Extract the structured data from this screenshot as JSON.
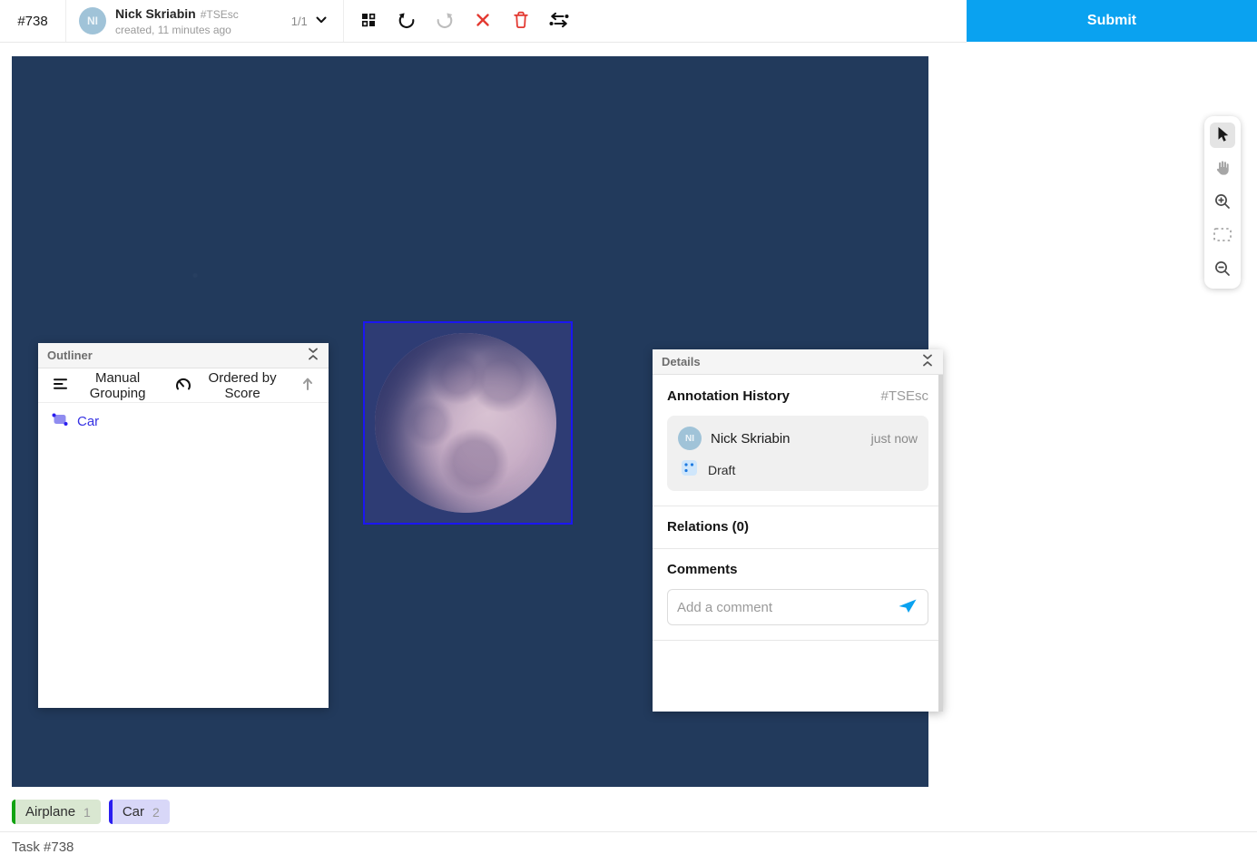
{
  "header": {
    "task_id": "#738",
    "user": {
      "initials": "NI",
      "name": "Nick Skriabin",
      "ref": "#TSEsc",
      "created": "created, 11 minutes ago"
    },
    "pager": "1/1",
    "submit_label": "Submit"
  },
  "outliner": {
    "title": "Outliner",
    "grouping_label": "Manual Grouping",
    "ordering_label": "Ordered by Score",
    "regions": [
      {
        "label": "Car"
      }
    ]
  },
  "details": {
    "title": "Details",
    "annotation_history_title": "Annotation History",
    "annotation_ref": "#TSEsc",
    "history": [
      {
        "initials": "NI",
        "name": "Nick Skriabin",
        "time": "just now",
        "status": "Draft"
      }
    ],
    "relations_title": "Relations (0)",
    "comments_title": "Comments",
    "comment_placeholder": "Add a comment"
  },
  "labels": [
    {
      "name": "Airplane",
      "hotkey": "1",
      "bar_color": "#12a312",
      "bg_color": "#d9e7d1"
    },
    {
      "name": "Car",
      "hotkey": "2",
      "bar_color": "#2a1df0",
      "bg_color": "#d8d7f8"
    }
  ],
  "statusbar": {
    "task_label": "Task #738"
  },
  "colors": {
    "accent_blue": "#0aa2f0",
    "bbox_blue": "#1b16f2",
    "canvas_navy": "#223a5c",
    "selection_navy": "#2e3c74",
    "danger_red": "#e33a32",
    "avatar_blue": "#a0c3d8"
  }
}
